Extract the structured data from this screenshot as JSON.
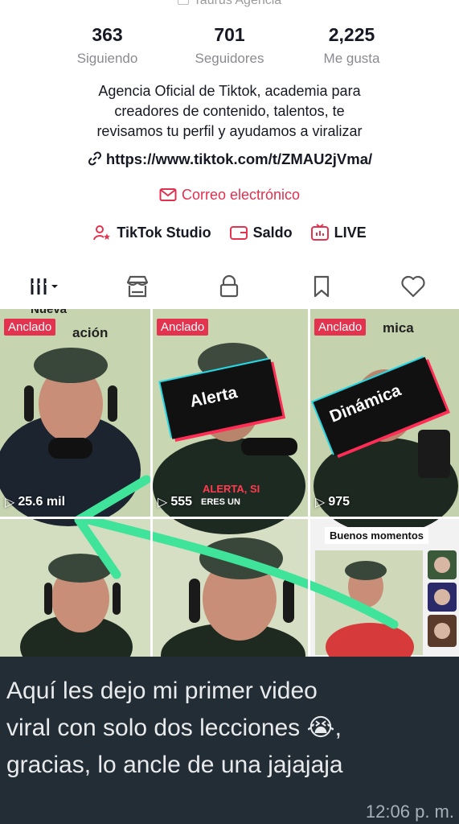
{
  "profile": {
    "display_name": "Taurus Agencia",
    "stats": [
      {
        "value": "363",
        "label": "Siguiendo"
      },
      {
        "value": "701",
        "label": "Seguidores"
      },
      {
        "value": "2,225",
        "label": "Me gusta"
      }
    ],
    "bio_lines": [
      "Agencia Oficial de Tiktok, academia para",
      "creadores de contenido, talentos, te",
      "revisamos tu perfil y ayudamos a viralizar"
    ],
    "link": "https://www.tiktok.com/t/ZMAU2jVma/",
    "email_label": "Correo electrónico",
    "tools": {
      "studio": "TikTok Studio",
      "balance": "Saldo",
      "live": "LIVE"
    }
  },
  "tabs": [
    "videos-icon",
    "shop-icon",
    "lock-icon",
    "bookmark-icon",
    "heart-icon"
  ],
  "videos": [
    {
      "pinned": "Anclado",
      "views": "25.6 mil",
      "overlay": "ación",
      "overlay_top": "Nueva"
    },
    {
      "pinned": "Anclado",
      "views": "555",
      "sticker": "Alerta",
      "caption_1": "ALERTA, SI",
      "caption_2": "ERES UN"
    },
    {
      "pinned": "Anclado",
      "views": "975",
      "sticker": "Dinámica",
      "overlay": "mica"
    },
    {
      "views": ""
    },
    {
      "views": ""
    },
    {
      "views": "",
      "banner": "Buenos momentos"
    }
  ],
  "message": {
    "lines": [
      "Aquí les dejo mi primer video",
      "viral con solo dos lecciones 😭,",
      "gracias,  lo ancle de una jajajaja"
    ],
    "time": "12:06 p. m."
  },
  "colors": {
    "accent": "#e4334f",
    "arrow": "#3fe39a",
    "chat_bg": "#232d36"
  }
}
